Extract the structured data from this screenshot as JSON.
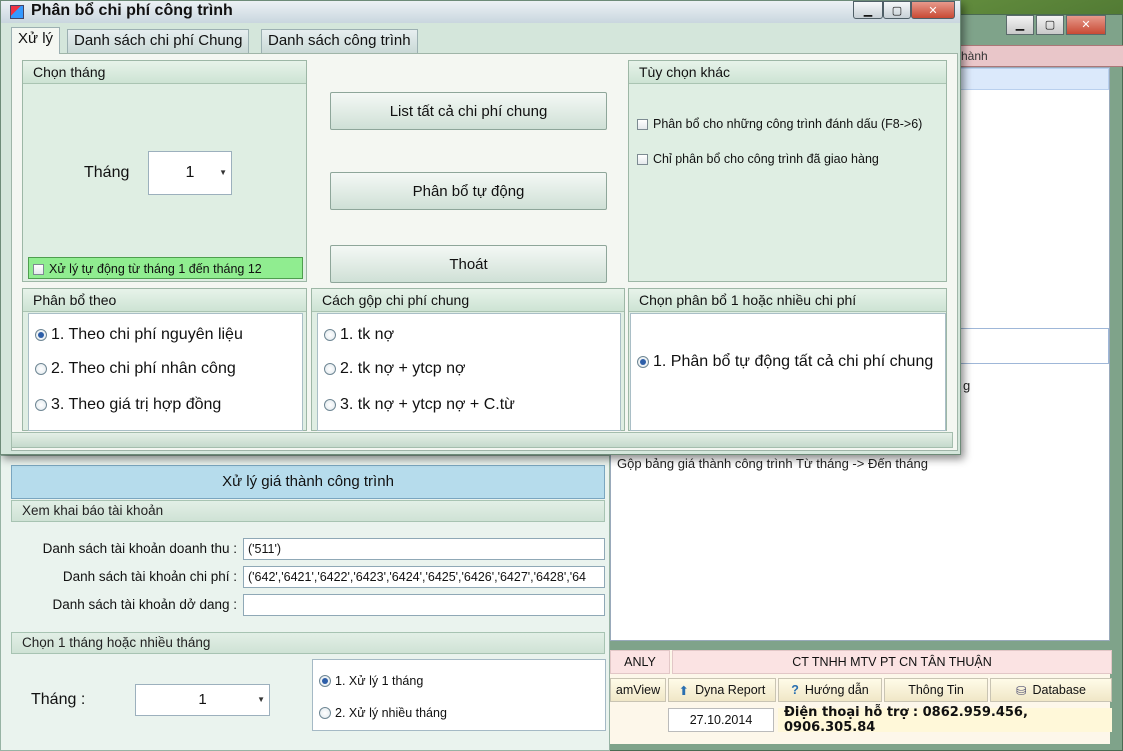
{
  "main_window": {
    "tab_fragment": "hành",
    "text_fragment_1": "g",
    "text_fragment_2": "Gộp bảng giá thành công trình Từ tháng -> Đến tháng",
    "footer": {
      "company_short": "ANLY",
      "company_name": "CT TNHH MTV PT CN TÂN THUẬN",
      "tool_teamview": "amView",
      "tool_dyna": "Dyna Report",
      "tool_help": "Hướng dẫn",
      "tool_info": "Thông Tin",
      "tool_db": "Database",
      "date": "27.10.2014",
      "phone": "Điện thoại hỗ trợ : 0862.959.456, 0906.305.84"
    }
  },
  "xuly_panel": {
    "title": "Xử lý giá thành công trình",
    "section_accounts": "Xem khai báo tài khoản",
    "revenue_label": "Danh sách tài khoản doanh thu :",
    "revenue_value": "('511')",
    "expense_label": "Danh sách tài khoản chi phí :",
    "expense_value": "('642','6421','6422','6423','6424','6425','6426','6427','6428','64",
    "wip_label": "Danh sách tài khoản dở dang :",
    "wip_value": "",
    "section_months": "Chọn 1 tháng hoặc nhiều tháng",
    "month_label": "Tháng :",
    "month_value": "1",
    "radio_single": "1. Xử lý 1 tháng",
    "radio_multi": "2. Xử lý nhiều tháng"
  },
  "dialog": {
    "title": "Phân bổ chi phí công trình",
    "tabs": [
      "Xử lý",
      "Danh sách chi phí Chung",
      "Danh sách công trình"
    ],
    "month_group": {
      "header": "Chọn tháng",
      "label": "Tháng",
      "value": "1",
      "auto_checkbox": "Xử lý tự động từ tháng 1 đến tháng 12"
    },
    "buttons": {
      "list_all": "List tất cả chi phí chung",
      "auto_alloc": "Phân bổ tự động",
      "exit": "Thoát"
    },
    "options_group": {
      "header": "Tùy chọn khác",
      "opt1": "Phân bổ cho những công trình đánh dấu (F8->6)",
      "opt2": "Chỉ phân bổ cho công trình đã giao hàng"
    },
    "alloc_by": {
      "header": "Phân bổ theo",
      "items": [
        "1. Theo chi phí nguyên liệu",
        "2. Theo chi phí nhân công",
        "3. Theo giá trị hợp đồng"
      ]
    },
    "merge_group": {
      "header": "Cách gộp chi phí chung",
      "items": [
        "1. tk nợ",
        "2. tk nợ + ytcp nợ",
        "3. tk nợ + ytcp nợ + C.từ"
      ]
    },
    "choose_group": {
      "header": "Chọn phân bổ 1 hoặc nhiều chi phí",
      "item": "1. Phân bổ tự động tất cả chi phí chung"
    }
  }
}
